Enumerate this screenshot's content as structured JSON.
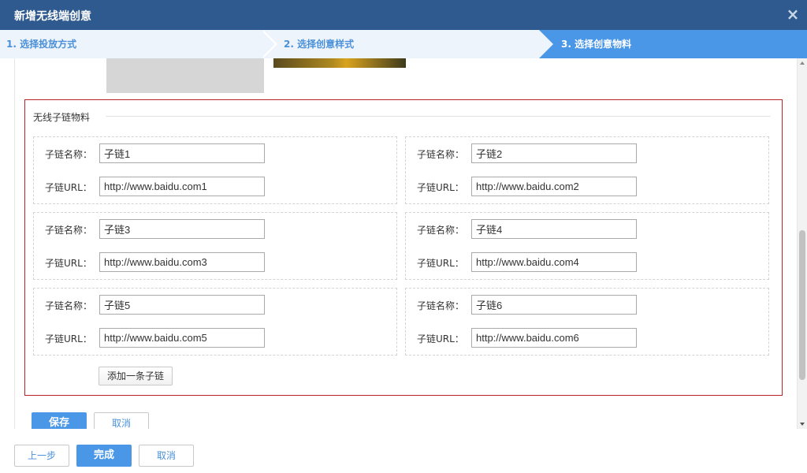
{
  "dialog": {
    "title": "新增无线端创意",
    "close_icon": "×"
  },
  "steps": [
    {
      "label": "1. 选择投放方式"
    },
    {
      "label": "2. 选择创意样式"
    },
    {
      "label": "3. 选择创意物料"
    }
  ],
  "material": {
    "section_title": "无线子链物料",
    "name_label": "子链名称：",
    "url_label": "子链URL：",
    "sublinks": [
      {
        "name": "子链1",
        "url": "http://www.baidu.com1"
      },
      {
        "name": "子链2",
        "url": "http://www.baidu.com2"
      },
      {
        "name": "子链3",
        "url": "http://www.baidu.com3"
      },
      {
        "name": "子链4",
        "url": "http://www.baidu.com4"
      },
      {
        "name": "子链5",
        "url": "http://www.baidu.com5"
      },
      {
        "name": "子链6",
        "url": "http://www.baidu.com6"
      }
    ],
    "add_label": "添加一条子链"
  },
  "inner_actions": {
    "save_label": "保存",
    "cancel_label": "取消"
  },
  "footer": {
    "prev_label": "上一步",
    "done_label": "完成",
    "cancel_label": "取消"
  },
  "colors": {
    "titlebar": "#2f5a8f",
    "accent": "#4a97e8",
    "material_border": "#b8222a"
  }
}
